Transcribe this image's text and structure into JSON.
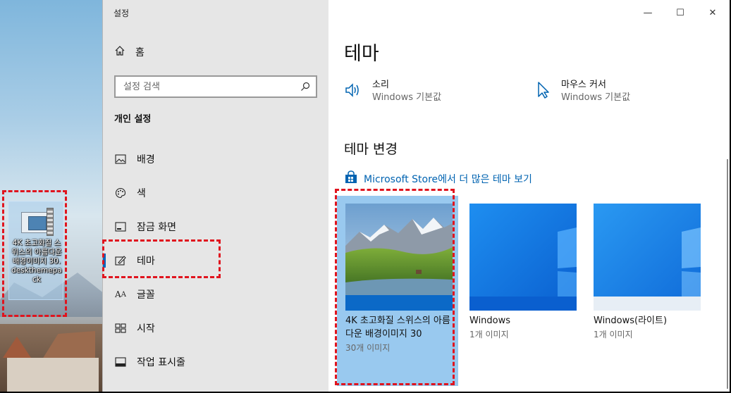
{
  "desktop": {
    "file_icon_label": "4K 초고화질 스위스의 아름다운 배경이미지 30.deskthemepack"
  },
  "window": {
    "title": "설정",
    "controls": {
      "minimize": "—",
      "maximize": "☐",
      "close": "✕"
    }
  },
  "sidebar": {
    "home_label": "홈",
    "search_placeholder": "설정 검색",
    "section_title": "개인 설정",
    "items": [
      {
        "label": "배경",
        "icon": "picture-icon"
      },
      {
        "label": "색",
        "icon": "palette-icon"
      },
      {
        "label": "잠금 화면",
        "icon": "lock-screen-icon"
      },
      {
        "label": "테마",
        "icon": "theme-brush-icon",
        "selected": true
      },
      {
        "label": "글꼴",
        "icon": "font-icon"
      },
      {
        "label": "시작",
        "icon": "start-icon"
      },
      {
        "label": "작업 표시줄",
        "icon": "taskbar-icon"
      }
    ]
  },
  "main": {
    "page_title": "테마",
    "quick_settings": [
      {
        "title": "소리",
        "subtitle": "Windows 기본값",
        "icon": "speaker-icon"
      },
      {
        "title": "마우스 커서",
        "subtitle": "Windows 기본값",
        "icon": "cursor-icon"
      }
    ],
    "change_theme_title": "테마 변경",
    "store_link": "Microsoft Store에서 더 많은 테마 보기",
    "themes": [
      {
        "name": "4K 초고화질 스위스의 아름다운 배경이미지 30",
        "count": "30개 이미지",
        "selected": true
      },
      {
        "name": "Windows",
        "count": "1개 이미지"
      },
      {
        "name": "Windows(라이트)",
        "count": "1개 이미지"
      }
    ]
  },
  "colors": {
    "accent": "#0067c0",
    "selected_theme_bg": "#99c9ef",
    "highlight_box": "#e0141e"
  }
}
